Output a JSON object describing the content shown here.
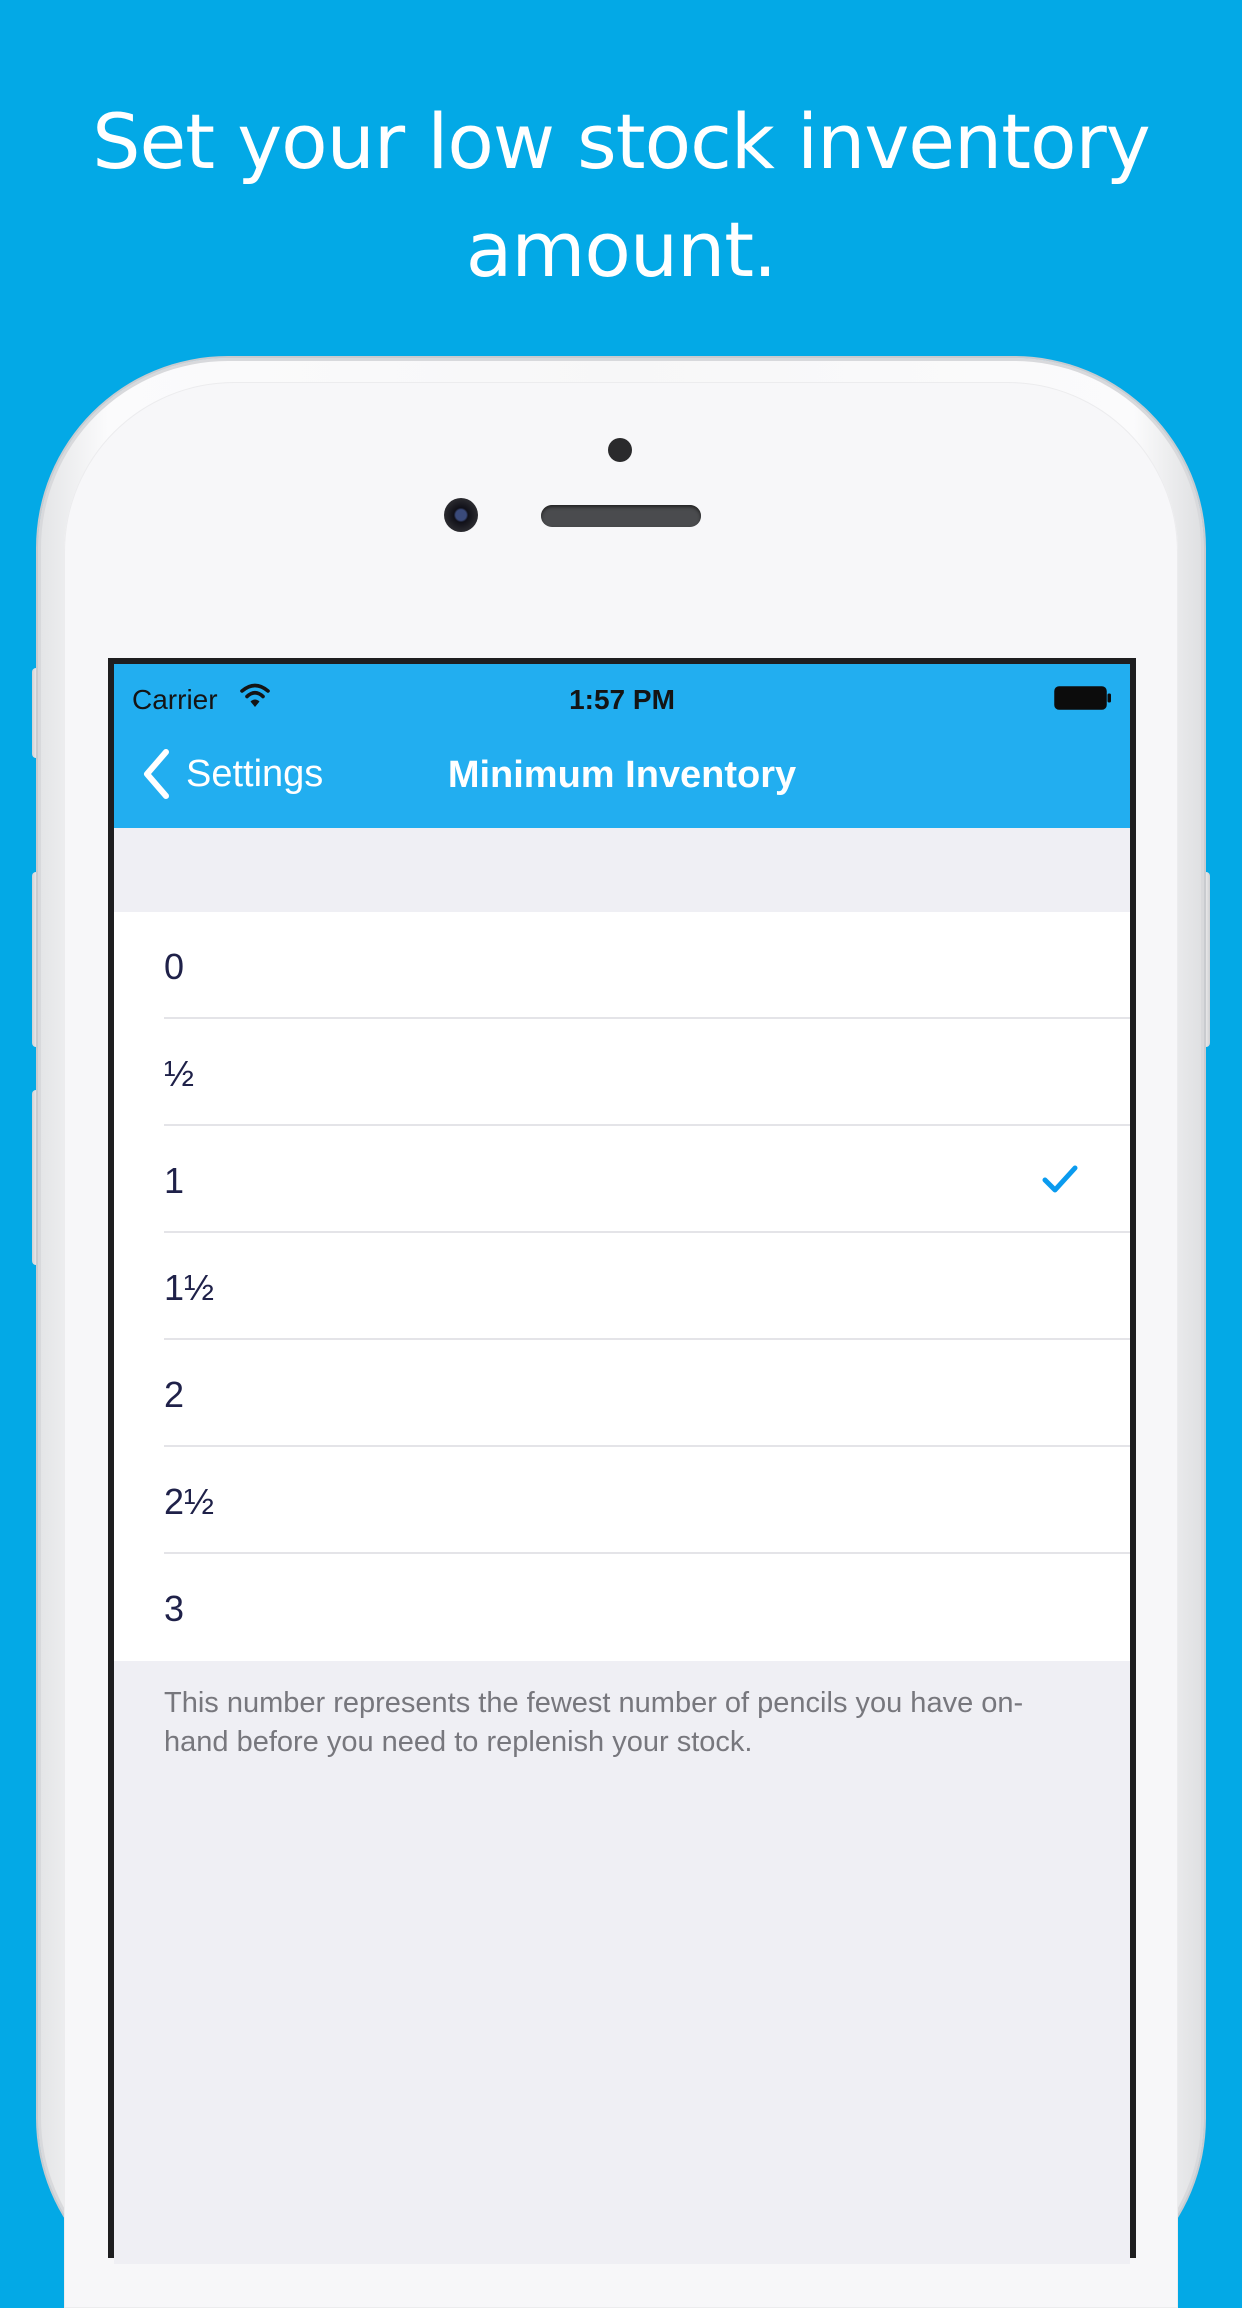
{
  "headline": {
    "line1": "Set your low stock inventory",
    "line2": "amount."
  },
  "status_bar": {
    "carrier": "Carrier",
    "time": "1:57 PM",
    "wifi_icon": "wifi-icon",
    "battery_icon": "battery-icon"
  },
  "nav": {
    "back_label": "Settings",
    "back_icon": "chevron-left-icon",
    "title": "Minimum Inventory"
  },
  "options": [
    {
      "label": "0",
      "selected": false
    },
    {
      "label": "½",
      "selected": false
    },
    {
      "label": "1",
      "selected": true
    },
    {
      "label": "1½",
      "selected": false
    },
    {
      "label": "2",
      "selected": false
    },
    {
      "label": "2½",
      "selected": false
    },
    {
      "label": "3",
      "selected": false
    }
  ],
  "footer_note": "This number represents the fewest number of pencils you have on-hand before you need to replenish your stock.",
  "colors": {
    "background": "#03a9e6",
    "nav_bar": "#22aef0",
    "accent": "#0a9bef",
    "row_text": "#1f2149"
  }
}
